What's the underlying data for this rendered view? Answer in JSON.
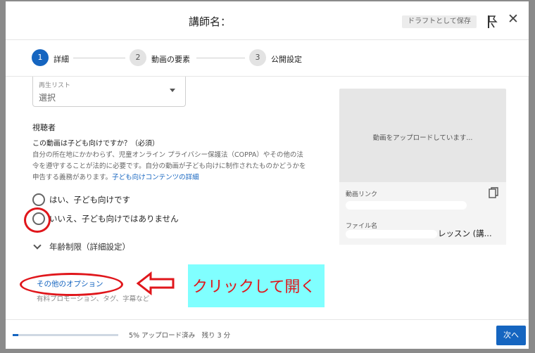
{
  "header": {
    "title": "講師名：",
    "draft_button": "ドラフトとして保存",
    "icons": {
      "flag": "feedback-flag-icon",
      "close": "close-icon"
    }
  },
  "stepper": {
    "steps": [
      {
        "number": "1",
        "label": "詳細",
        "active": true
      },
      {
        "number": "2",
        "label": "動画の要素",
        "active": false
      },
      {
        "number": "3",
        "label": "公開設定",
        "active": false
      }
    ]
  },
  "playlist": {
    "label": "再生リスト",
    "value": "選択"
  },
  "audience": {
    "heading": "視聴者",
    "question": "この動画は子ども向けですか？（必須）",
    "description_line1": "自分の所在地にかかわらず、児童オンライン プライバシー保護法（COPPA）やその他の法",
    "description_line2": "令を遵守することが法的に必要です。自分の動画が子ども向けに制作されたものかどうかを",
    "description_line3": "申告する義務があります。",
    "description_link": "子ども向けコンテンツの詳細",
    "options": [
      {
        "label": "はい、子ども向けです",
        "selected": false
      },
      {
        "label": "いいえ、子ども向けではありません",
        "selected": false
      }
    ]
  },
  "age_restriction": {
    "label": "年齢制限（詳細設定）"
  },
  "more_options": {
    "label": "その他のオプション",
    "sub": "有料プロモーション、タグ、字幕など"
  },
  "annotation": {
    "callout_text": "クリックして開く",
    "color": "#e0161b",
    "box_color": "#80ffff"
  },
  "preview": {
    "status": "動画をアップロードしています...",
    "link_label": "動画リンク",
    "filename_label": "ファイル名",
    "filename_value": "レッスン (講..."
  },
  "footer": {
    "progress_text": "5% アップロード済み　残り 3 分",
    "progress_value": 0.05,
    "next_button": "次へ"
  },
  "colors": {
    "accent": "#1565c0",
    "annotation_red": "#e0161b"
  }
}
